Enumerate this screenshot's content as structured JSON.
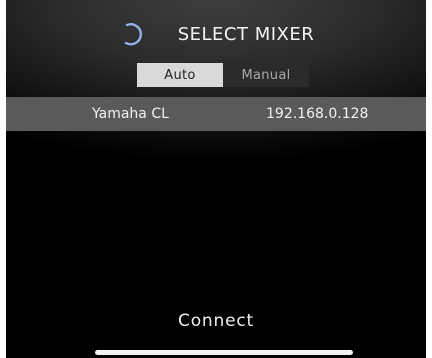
{
  "header": {
    "title": "SELECT MIXER",
    "spinner_icon": "loading-spinner-icon"
  },
  "mode_toggle": {
    "options": [
      {
        "label": "Auto",
        "selected": true
      },
      {
        "label": "Manual",
        "selected": false
      }
    ]
  },
  "mixers": [
    {
      "name": "Yamaha CL",
      "ip": "192.168.0.128"
    }
  ],
  "footer": {
    "connect_label": "Connect"
  },
  "colors": {
    "background": "#000000",
    "selected_row": "#5a5a5a",
    "toggle_active": "#d9d9d9",
    "toggle_inactive": "#2b2b2b",
    "text": "#f2f2f2"
  }
}
